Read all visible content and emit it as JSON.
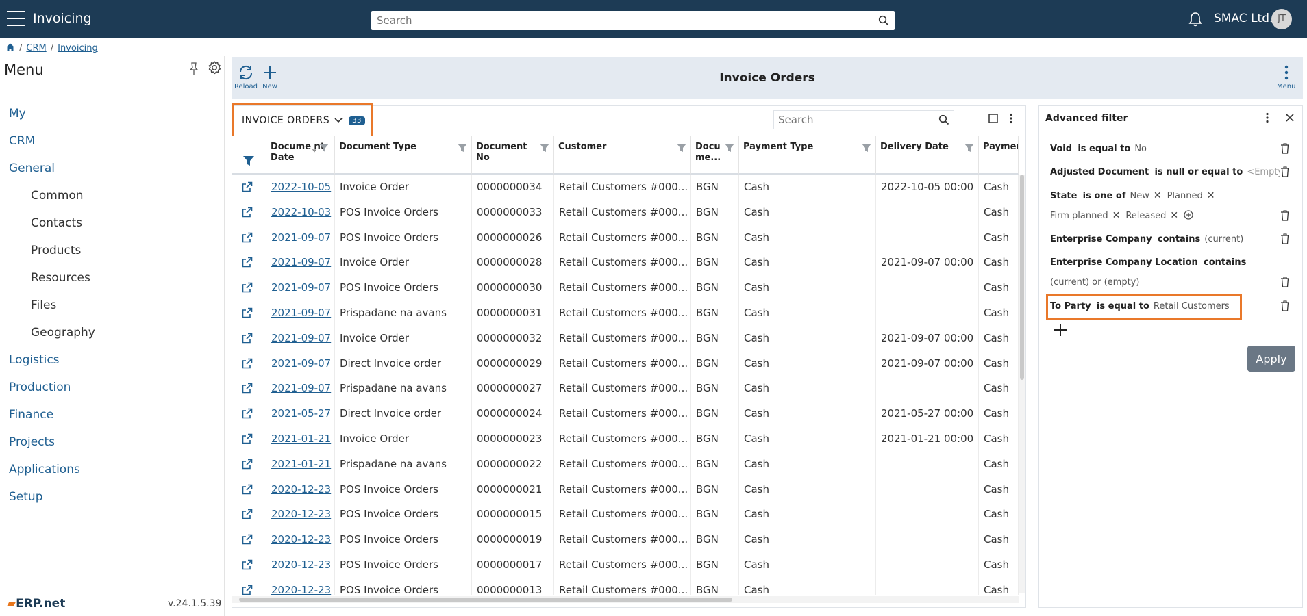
{
  "topbar": {
    "app_title": "Invoicing",
    "search_placeholder": "Search",
    "company": "SMAC Ltd.",
    "avatar_initials": "JT"
  },
  "breadcrumb": {
    "home_icon": "home-icon",
    "items": [
      "CRM",
      "Invoicing"
    ]
  },
  "sidebar": {
    "title": "Menu",
    "items": [
      {
        "label": "My"
      },
      {
        "label": "CRM"
      },
      {
        "label": "General"
      },
      {
        "label": "Common"
      },
      {
        "label": "Contacts"
      },
      {
        "label": "Products"
      },
      {
        "label": "Resources"
      },
      {
        "label": "Files"
      },
      {
        "label": "Geography"
      },
      {
        "label": "Logistics"
      },
      {
        "label": "Production"
      },
      {
        "label": "Finance"
      },
      {
        "label": "Projects"
      },
      {
        "label": "Applications"
      },
      {
        "label": "Setup"
      }
    ],
    "brand": "ERP.net",
    "version": "v.24.1.5.39"
  },
  "toolbar": {
    "reload_label": "Reload",
    "new_label": "New",
    "title": "Invoice Orders",
    "menu_label": "Menu"
  },
  "grid": {
    "title": "INVOICE ORDERS",
    "count": "33",
    "search_placeholder": "Search",
    "columns": [
      "Docume nt Date",
      "Document Type",
      "Document No",
      "Customer",
      "Docu me...",
      "Payment Type",
      "Delivery Date",
      "Paymer"
    ],
    "rows": [
      [
        "2022-10-05",
        "Invoice Order",
        "0000000034",
        "Retail Customers #000...",
        "BGN",
        "Cash",
        "2022-10-05 00:00",
        "Cash"
      ],
      [
        "2022-10-03",
        "POS Invoice Orders",
        "0000000033",
        "Retail Customers #000...",
        "BGN",
        "Cash",
        "",
        "Cash"
      ],
      [
        "2021-09-07",
        "POS Invoice Orders",
        "0000000026",
        "Retail Customers #000...",
        "BGN",
        "Cash",
        "",
        "Cash"
      ],
      [
        "2021-09-07",
        "Invoice Order",
        "0000000028",
        "Retail Customers #000...",
        "BGN",
        "Cash",
        "2021-09-07 00:00",
        "Cash"
      ],
      [
        "2021-09-07",
        "POS Invoice Orders",
        "0000000030",
        "Retail Customers #000...",
        "BGN",
        "Cash",
        "",
        "Cash"
      ],
      [
        "2021-09-07",
        "Prispadane na avans",
        "0000000031",
        "Retail Customers #000...",
        "BGN",
        "Cash",
        "",
        "Cash"
      ],
      [
        "2021-09-07",
        "Invoice Order",
        "0000000032",
        "Retail Customers #000...",
        "BGN",
        "Cash",
        "2021-09-07 00:00",
        "Cash"
      ],
      [
        "2021-09-07",
        "Direct Invoice order",
        "0000000029",
        "Retail Customers #000...",
        "BGN",
        "Cash",
        "2021-09-07 00:00",
        "Cash"
      ],
      [
        "2021-09-07",
        "Prispadane na avans",
        "0000000027",
        "Retail Customers #000...",
        "BGN",
        "Cash",
        "",
        "Cash"
      ],
      [
        "2021-05-27",
        "Direct Invoice order",
        "0000000024",
        "Retail Customers #000...",
        "BGN",
        "Cash",
        "2021-05-27 00:00",
        "Cash"
      ],
      [
        "2021-01-21",
        "Invoice Order",
        "0000000023",
        "Retail Customers #000...",
        "BGN",
        "Cash",
        "2021-01-21 00:00",
        "Cash"
      ],
      [
        "2021-01-21",
        "Prispadane na avans",
        "0000000022",
        "Retail Customers #000...",
        "BGN",
        "Cash",
        "",
        "Cash"
      ],
      [
        "2020-12-23",
        "POS Invoice Orders",
        "0000000021",
        "Retail Customers #000...",
        "BGN",
        "Cash",
        "",
        "Cash"
      ],
      [
        "2020-12-23",
        "POS Invoice Orders",
        "0000000015",
        "Retail Customers #000...",
        "BGN",
        "Cash",
        "",
        "Cash"
      ],
      [
        "2020-12-23",
        "POS Invoice Orders",
        "0000000019",
        "Retail Customers #000...",
        "BGN",
        "Cash",
        "",
        "Cash"
      ],
      [
        "2020-12-23",
        "POS Invoice Orders",
        "0000000017",
        "Retail Customers #000...",
        "BGN",
        "Cash",
        "",
        "Cash"
      ],
      [
        "2020-12-23",
        "POS Invoice Orders",
        "0000000013",
        "Retail Customers #000...",
        "BGN",
        "Cash",
        "",
        "Cash"
      ]
    ]
  },
  "filter": {
    "title": "Advanced filter",
    "void_field": "Void",
    "void_op": "is equal to",
    "void_value": "No",
    "adj_field": "Adjusted Document",
    "adj_op": "is null or equal to",
    "adj_value": "<Empty>",
    "state_field": "State",
    "state_op": "is one of",
    "state_values": [
      "New",
      "Planned",
      "Firm planned",
      "Released"
    ],
    "company_field": "Enterprise Company",
    "company_op": "contains",
    "company_value": "(current)",
    "location_field": "Enterprise Company Location",
    "location_op": "contains",
    "location_value": "(current) or (empty)",
    "party_field": "To Party",
    "party_op": "is equal to",
    "party_value": "Retail Customers",
    "apply_label": "Apply"
  },
  "colors": {
    "topbar": "#1d3b55",
    "accent": "#1f5f91",
    "highlight": "#e9782a",
    "toolbar": "#e4eaf1"
  }
}
